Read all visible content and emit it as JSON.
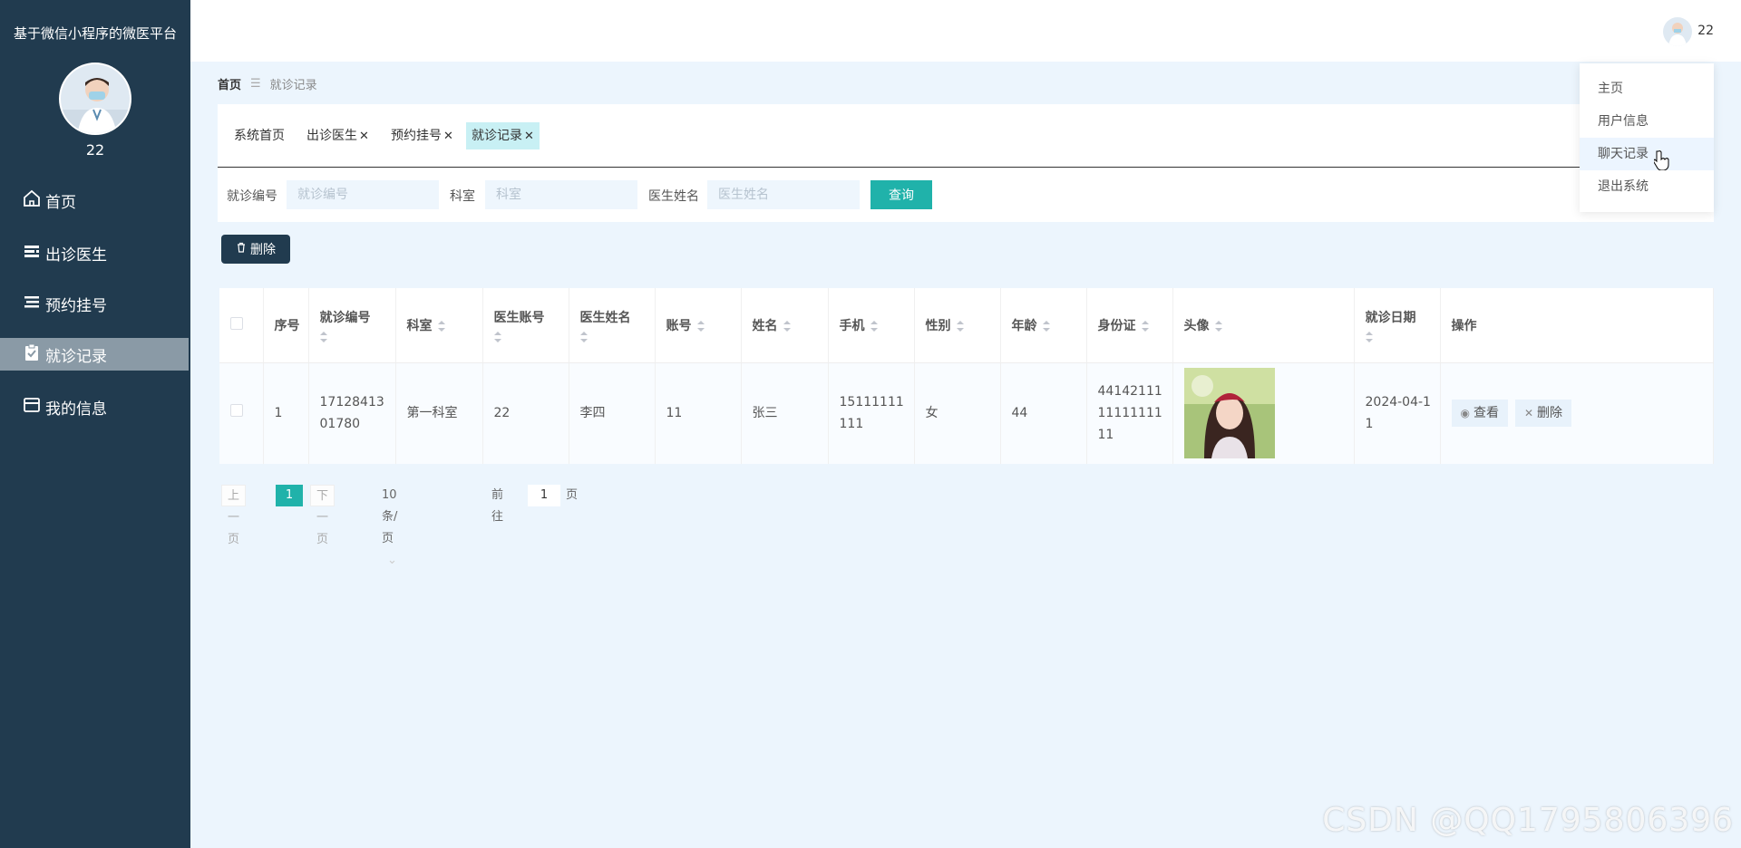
{
  "sidebar": {
    "app_title": "基于微信小程序的微医平台",
    "username": "22",
    "items": [
      {
        "label": "首页",
        "icon": "home-icon"
      },
      {
        "label": "出诊医生",
        "icon": "list-icon"
      },
      {
        "label": "预约挂号",
        "icon": "list-icon"
      },
      {
        "label": "就诊记录",
        "icon": "clipboard-check-icon",
        "active": true
      },
      {
        "label": "我的信息",
        "icon": "card-icon"
      }
    ]
  },
  "header": {
    "username": "22"
  },
  "dropdown": {
    "items": [
      "主页",
      "用户信息",
      "聊天记录",
      "退出系统"
    ],
    "hovered": "聊天记录"
  },
  "breadcrumb": {
    "home": "首页",
    "sep": "☰",
    "current": "就诊记录"
  },
  "tabs": [
    {
      "label": "系统首页",
      "closable": false
    },
    {
      "label": "出诊医生",
      "closable": true
    },
    {
      "label": "预约挂号",
      "closable": true
    },
    {
      "label": "就诊记录",
      "closable": true,
      "active": true
    }
  ],
  "search": {
    "fields": [
      {
        "label": "就诊编号",
        "placeholder": "就诊编号"
      },
      {
        "label": "科室",
        "placeholder": "科室"
      },
      {
        "label": "医生姓名",
        "placeholder": "医生姓名"
      }
    ],
    "query_label": "查询"
  },
  "toolbar": {
    "delete_label": "删除"
  },
  "table": {
    "headers": [
      "序号",
      "就诊编号",
      "科室",
      "医生账号",
      "医生姓名",
      "账号",
      "姓名",
      "手机",
      "性别",
      "年龄",
      "身份证",
      "头像",
      "就诊日期",
      "操作"
    ],
    "rows": [
      {
        "index": "1",
        "visit_no": "1712841301780",
        "dept": "第一科室",
        "doctor_account": "22",
        "doctor_name": "李四",
        "account": "11",
        "name": "张三",
        "phone": "15111111111",
        "gender": "女",
        "age": "44",
        "id_card": "441421111111111111",
        "visit_date": "2024-04-11",
        "view_label": "查看",
        "delete_label": "删除"
      }
    ]
  },
  "pager": {
    "prev": "上一页",
    "current": "1",
    "next": "下一页",
    "size": "10条/页",
    "goto_prefix": "前往",
    "goto_value": "1",
    "goto_suffix": "页"
  },
  "watermark": "CSDN @QQ1795806396",
  "colors": {
    "sidebar_bg": "#213b4f",
    "accent": "#20b2aa",
    "page_bg": "#ecf5fd"
  }
}
